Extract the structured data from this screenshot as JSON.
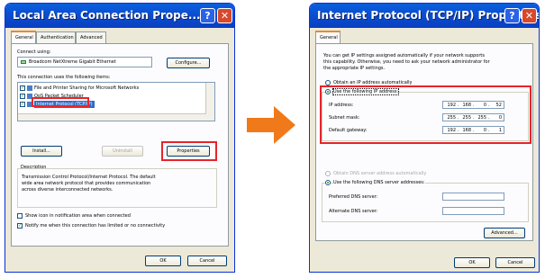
{
  "left_dialog": {
    "title": "Local Area Connection Prope...",
    "tabs": [
      "General",
      "Authentication",
      "Advanced"
    ],
    "connect_using_label": "Connect using:",
    "adapter_name": "Broadcom NetXtreme Gigabit Ethernet",
    "configure_button": "Configure...",
    "items_label": "This connection uses the following items:",
    "items": [
      "File and Printer Sharing for Microsoft Networks",
      "QoS Packet Scheduler",
      "Internet Protocol (TCP/IP)"
    ],
    "install_button": "Install...",
    "uninstall_button": "Uninstall",
    "properties_button": "Properties",
    "description_label": "Description",
    "description_lines": [
      "Transmission Control Protocol/Internet Protocol. The default",
      "wide area network protocol that provides communication",
      "across diverse interconnected networks."
    ],
    "show_icon_label": "Show icon in notification area when connected",
    "notify_label": "Notify me when this connection has limited or no connectivity",
    "ok_button": "OK",
    "cancel_button": "Cancel"
  },
  "arrow": {
    "color": "#f07a1a"
  },
  "right_dialog": {
    "title": "Internet Protocol (TCP/IP) Properties",
    "tab": "General",
    "intro_lines": [
      "You can get IP settings assigned automatically if your network supports",
      "this capability. Otherwise, you need to ask your network administrator for",
      "the appropriate IP settings."
    ],
    "obtain_ip_label": "Obtain an IP address automatically",
    "use_ip_label": "Use the following IP address:",
    "ip_address_label": "IP address:",
    "ip_address": [
      "192",
      "168",
      "0",
      "52"
    ],
    "subnet_label": "Subnet mask:",
    "subnet_mask": [
      "255",
      "255",
      "255",
      "0"
    ],
    "gateway_label": "Default gateway:",
    "gateway": [
      "192",
      "168",
      "0",
      "1"
    ],
    "obtain_dns_label": "Obtain DNS server address automatically",
    "use_dns_label": "Use the following DNS server addresses:",
    "preferred_dns_label": "Preferred DNS server:",
    "alternate_dns_label": "Alternate DNS server:",
    "advanced_button": "Advanced...",
    "ok_button": "OK",
    "cancel_button": "Cancel"
  },
  "colors": {
    "highlight_border": "#e8242a",
    "selected_item_bg": "#316ac5"
  }
}
